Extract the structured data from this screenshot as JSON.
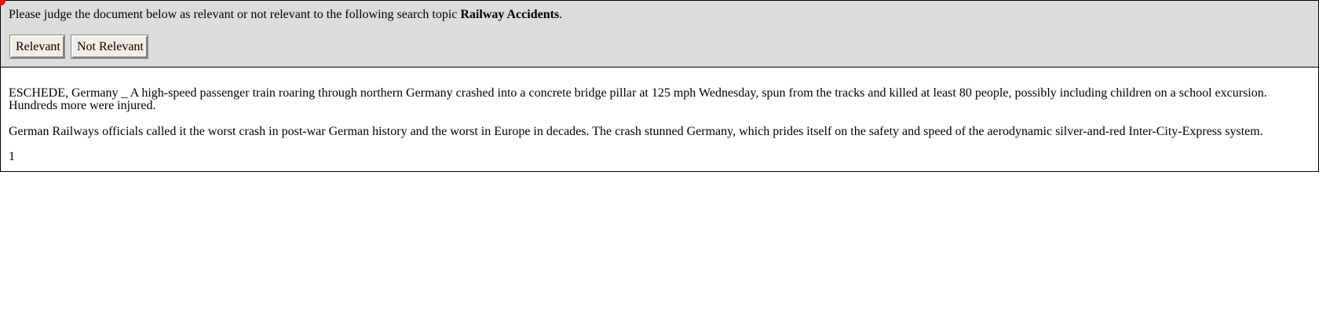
{
  "judge": {
    "prompt_prefix": "Please judge the document below as relevant or not relevant to the following search topic ",
    "topic": "Railway Accidents",
    "prompt_suffix": ".",
    "relevant_label": "Relevant",
    "not_relevant_label": "Not Relevant"
  },
  "document": {
    "paragraphs": [
      "ESCHEDE, Germany _ A high-speed passenger train roaring through northern Germany crashed into a concrete bridge pillar at 125 mph Wednesday, spun from the tracks and killed at least 80 people, possibly including children on a school excursion. Hundreds more were injured.",
      "German Railways officials called it the worst crash in post-war German history and the worst in Europe in decades. The crash stunned Germany, which prides itself on the safety and speed of the aerodynamic silver-and-red Inter-City-Express system."
    ],
    "page_number": "1"
  },
  "colors": {
    "header_bg": "#dcdcdc",
    "cursor_dot": "#ff0000"
  }
}
